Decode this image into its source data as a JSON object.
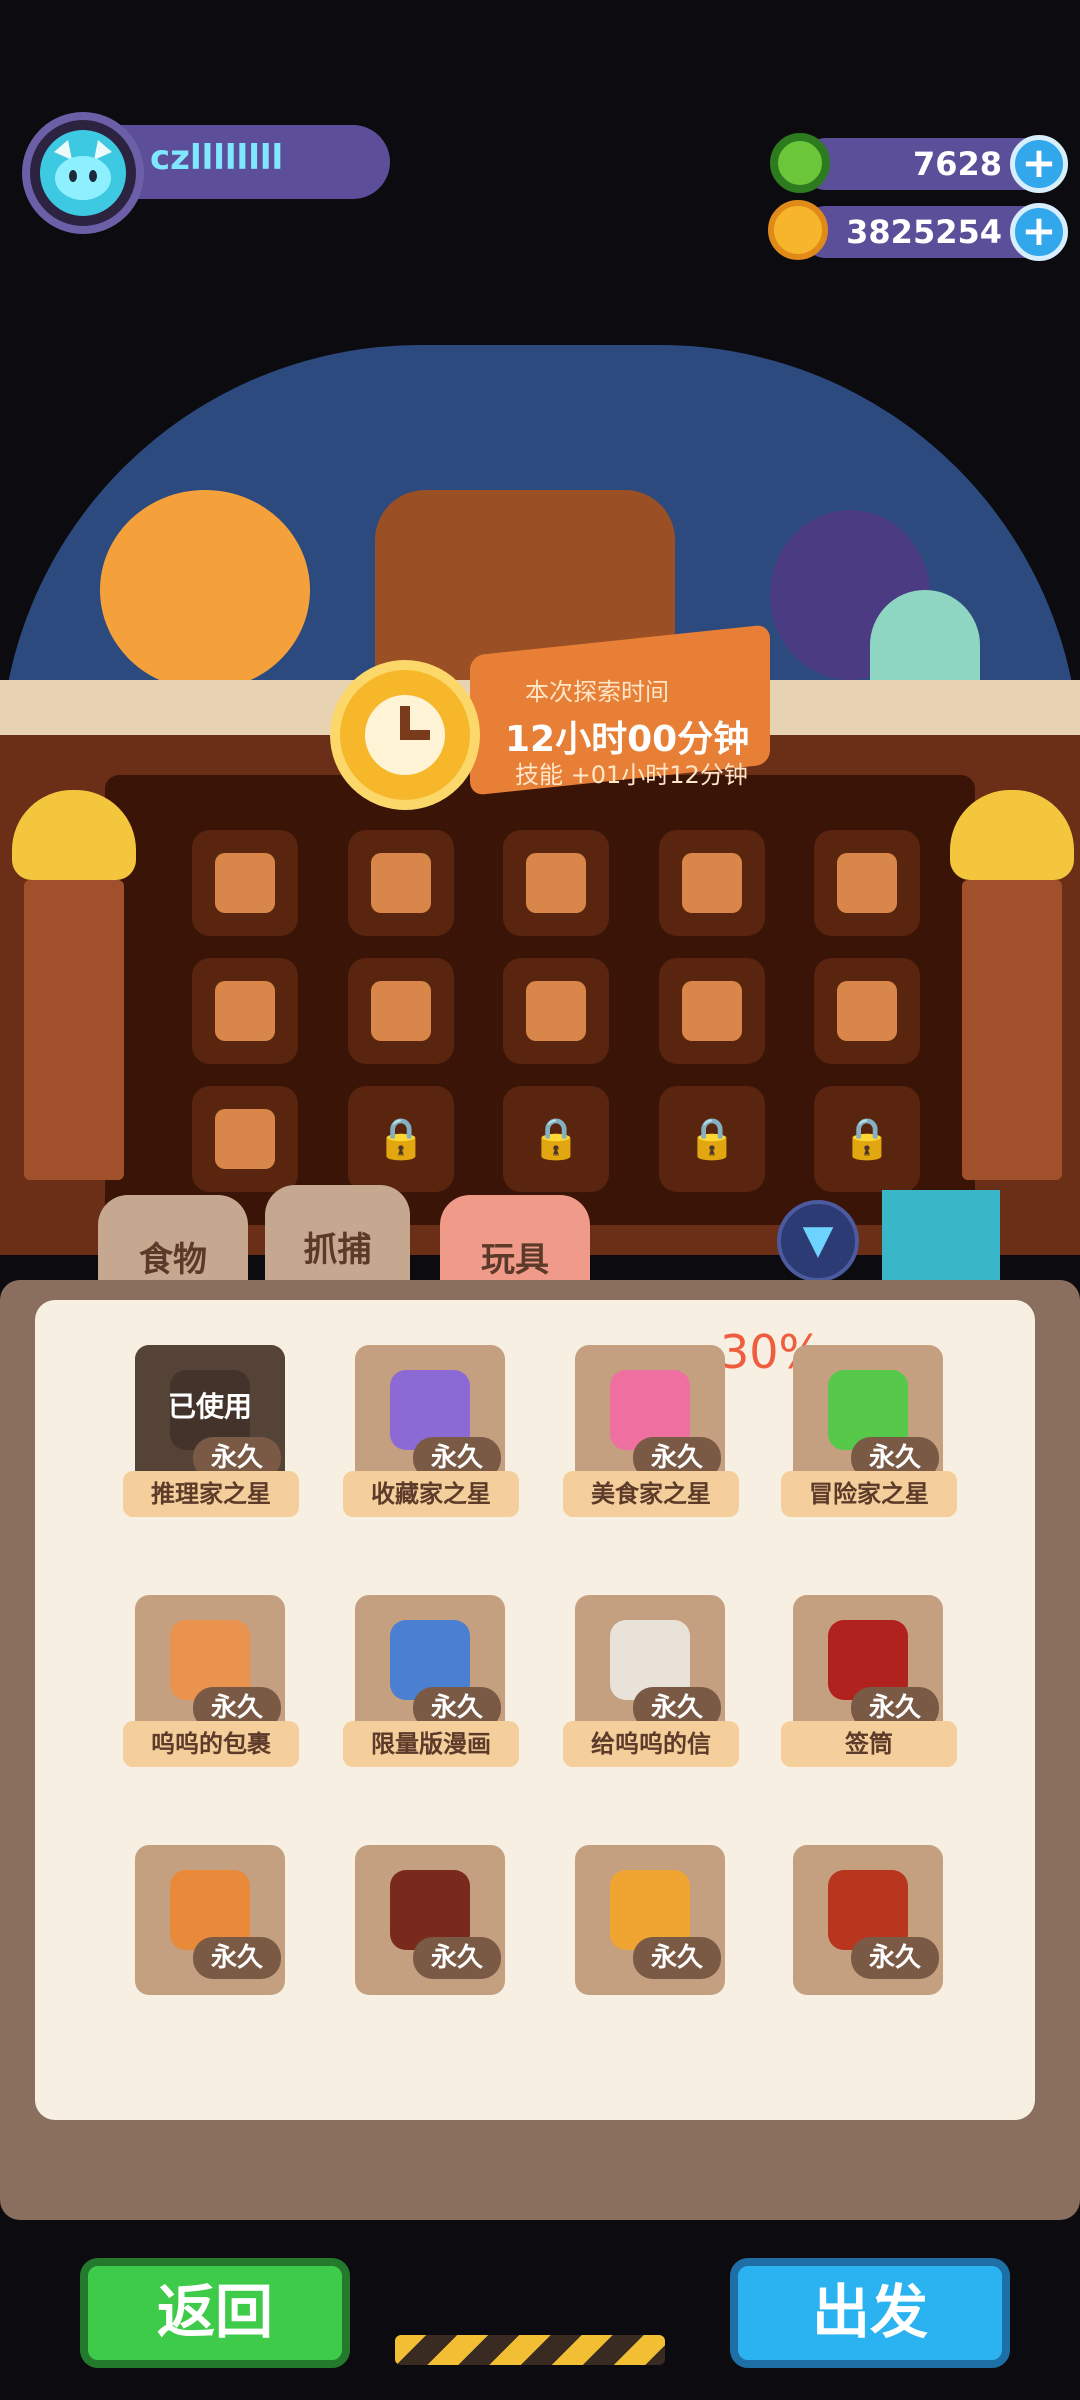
{
  "player": {
    "name": "czllllllll",
    "avatar_icon": "cat-face-icon"
  },
  "currency": {
    "gems": {
      "value": "7628",
      "icon": "green-donut-coin-icon"
    },
    "coins": {
      "value": "3825254",
      "icon": "planet-coin-icon"
    }
  },
  "expedition": {
    "banner_title": "本次探索时间",
    "duration": "12小时00分钟",
    "skill_bonus": "技能 +01小时12分钟"
  },
  "cabinet": {
    "slots": [
      {
        "icon": "signpost-icon",
        "locked": false
      },
      {
        "icon": "paw-pouch-icon",
        "locked": false
      },
      {
        "icon": "parcel-box-icon",
        "locked": false
      },
      {
        "icon": "letter-envelope-icon",
        "locked": false
      },
      {
        "icon": "sauce-bottle-icon",
        "locked": false
      },
      {
        "icon": "food-can-icon",
        "locked": false
      },
      {
        "icon": "can-box-icon",
        "locked": false
      },
      {
        "icon": "can-box-icon",
        "locked": false
      },
      {
        "icon": "can-box-icon",
        "locked": false
      },
      {
        "icon": "food-can-icon",
        "locked": false
      },
      {
        "icon": "food-basket-icon",
        "locked": false
      },
      {
        "icon": "lock-icon",
        "locked": true
      },
      {
        "icon": "lock-icon",
        "locked": true
      },
      {
        "icon": "lock-icon",
        "locked": true
      },
      {
        "icon": "lock-icon",
        "locked": true
      }
    ]
  },
  "tabs": [
    {
      "label": "食物"
    },
    {
      "label": "抓捕"
    },
    {
      "label": "玩具"
    }
  ],
  "inventory": {
    "discount_label": "30%",
    "cards": [
      {
        "name": "推理家之星",
        "perm": "永久",
        "status": "已使用",
        "color": "#8a6a56"
      },
      {
        "name": "收藏家之星",
        "perm": "永久",
        "color": "#8b6ad6"
      },
      {
        "name": "美食家之星",
        "perm": "永久",
        "color": "#ef6fa0"
      },
      {
        "name": "冒险家之星",
        "perm": "永久",
        "color": "#56c94a"
      },
      {
        "name": "呜呜的包裹",
        "perm": "永久",
        "color": "#e9934f"
      },
      {
        "name": "限量版漫画",
        "perm": "永久",
        "color": "#4a7fd1"
      },
      {
        "name": "给呜呜的信",
        "perm": "永久",
        "color": "#e8e2d8"
      },
      {
        "name": "签筒",
        "perm": "永久",
        "color": "#b0221e"
      },
      {
        "perm": "永久",
        "color": "#e98a3b"
      },
      {
        "perm": "永久",
        "color": "#7a2a1c"
      },
      {
        "perm": "永久",
        "color": "#f0a431"
      },
      {
        "perm": "永久",
        "color": "#b8361e"
      }
    ]
  },
  "buttons": {
    "back": "返回",
    "go": "出发"
  }
}
